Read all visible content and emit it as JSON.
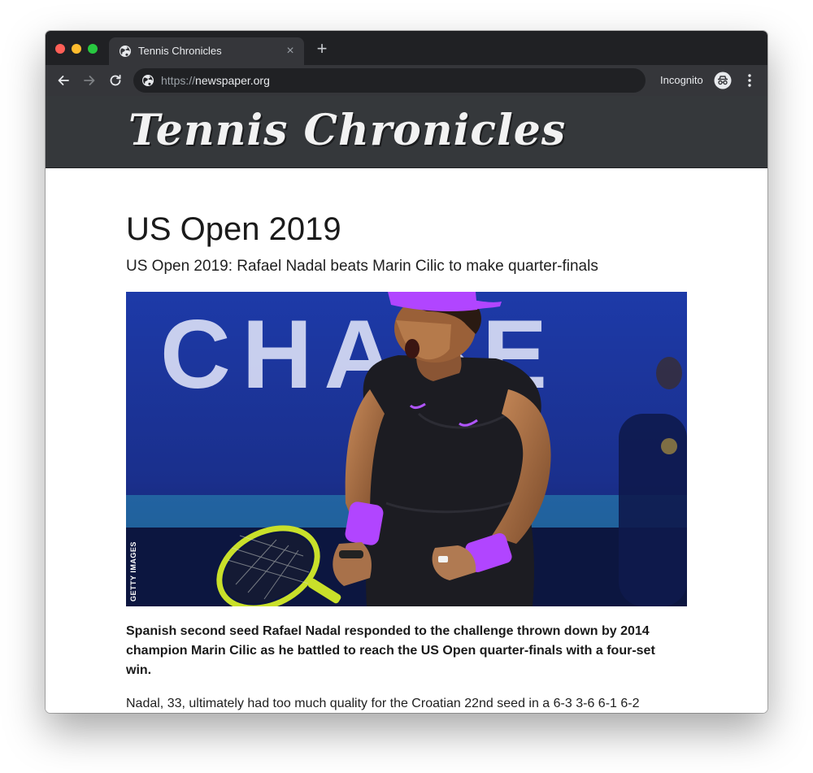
{
  "browser": {
    "tab": {
      "title": "Tennis Chronicles",
      "icon": "globe-icon",
      "close_icon": "close-icon",
      "close_glyph": "×"
    },
    "new_tab_glyph": "+",
    "address": {
      "scheme": "https://",
      "host": "newspaper.org",
      "icon": "globe-icon"
    },
    "incognito_label": "Incognito",
    "colors": {
      "tab_strip": "#202124",
      "toolbar": "#35363a",
      "omnibox": "#202124"
    }
  },
  "site": {
    "masthead_title": "Tennis Chronicles",
    "masthead_color": "#35383b"
  },
  "article": {
    "title": "US Open 2019",
    "subtitle": "US Open 2019: Rafael Nadal beats Marin Cilic to make quarter-finals",
    "image": {
      "subject": "Rafael Nadal celebrating with racket",
      "sign_text": "CHASE",
      "credit": "GETTY IMAGES"
    },
    "lead": "Spanish second seed Rafael Nadal responded to the challenge thrown down by 2014 champion Marin Cilic as he battled to reach the US Open quarter-finals with a four-set win.",
    "body": "Nadal, 33, ultimately had too much quality for the Croatian 22nd seed in a 6-3 3-6 6-1 6-2"
  }
}
